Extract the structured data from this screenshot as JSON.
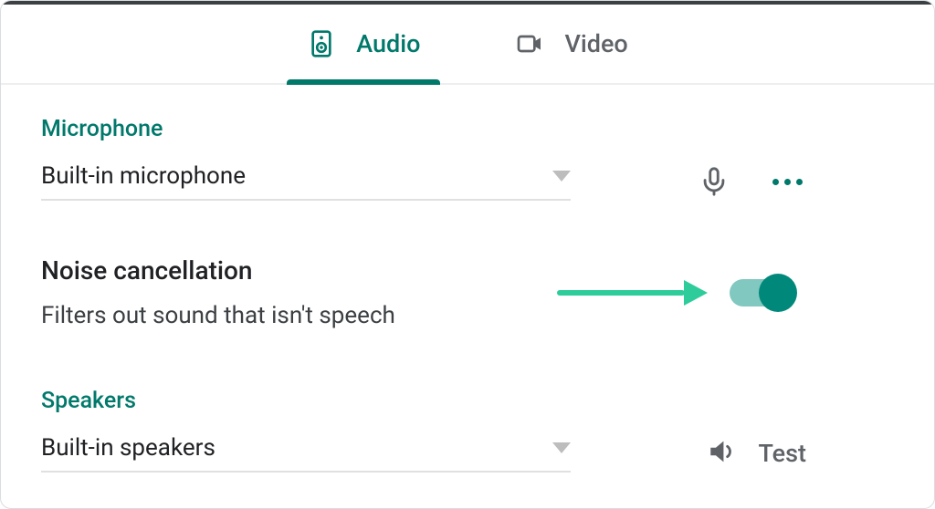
{
  "tabs": {
    "audio": "Audio",
    "video": "Video",
    "active": "audio"
  },
  "microphone": {
    "section_label": "Microphone",
    "selected": "Built-in microphone"
  },
  "noise_cancellation": {
    "title": "Noise cancellation",
    "description": "Filters out sound that isn't speech",
    "enabled": true
  },
  "speakers": {
    "section_label": "Speakers",
    "selected": "Built-in speakers",
    "test_label": "Test"
  },
  "colors": {
    "accent": "#00796b",
    "arrow": "#2ecc9a"
  }
}
